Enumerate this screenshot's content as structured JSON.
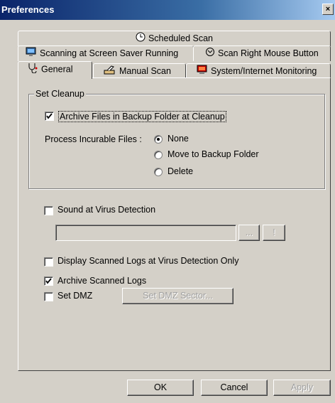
{
  "window": {
    "title": "Preferences",
    "close_glyph": "×"
  },
  "tabs": {
    "scheduled_scan": "Scheduled Scan",
    "screen_saver": "Scanning at Screen Saver Running",
    "right_mouse": "Scan Right Mouse Button",
    "general": "General",
    "manual_scan": "Manual Scan",
    "system_monitoring": "System/Internet Monitoring",
    "active": "General"
  },
  "cleanup": {
    "group_title": "Set Cleanup",
    "archive_label": "Archive Files in Backup Folder at Cleanup",
    "archive_checked": true,
    "process_label": "Process Incurable Files :",
    "options": [
      "None",
      "Move to Backup Folder",
      "Delete"
    ],
    "selected": "None"
  },
  "sound": {
    "label": "Sound at Virus Detection",
    "checked": false,
    "path_value": "",
    "browse_label": "...",
    "play_label": "!"
  },
  "display_logs": {
    "label": "Display Scanned Logs at Virus Detection Only",
    "checked": false
  },
  "archive_logs": {
    "label": "Archive Scanned Logs",
    "checked": true
  },
  "dmz": {
    "label": "Set DMZ",
    "checked": false,
    "button_label": "Set DMZ Sector..."
  },
  "buttons": {
    "ok": "OK",
    "cancel": "Cancel",
    "apply": "Apply"
  },
  "icons": [
    "clock-icon",
    "screensaver-icon",
    "mouse-icon",
    "stethoscope-icon",
    "manual-scan-icon",
    "monitor-icon"
  ]
}
